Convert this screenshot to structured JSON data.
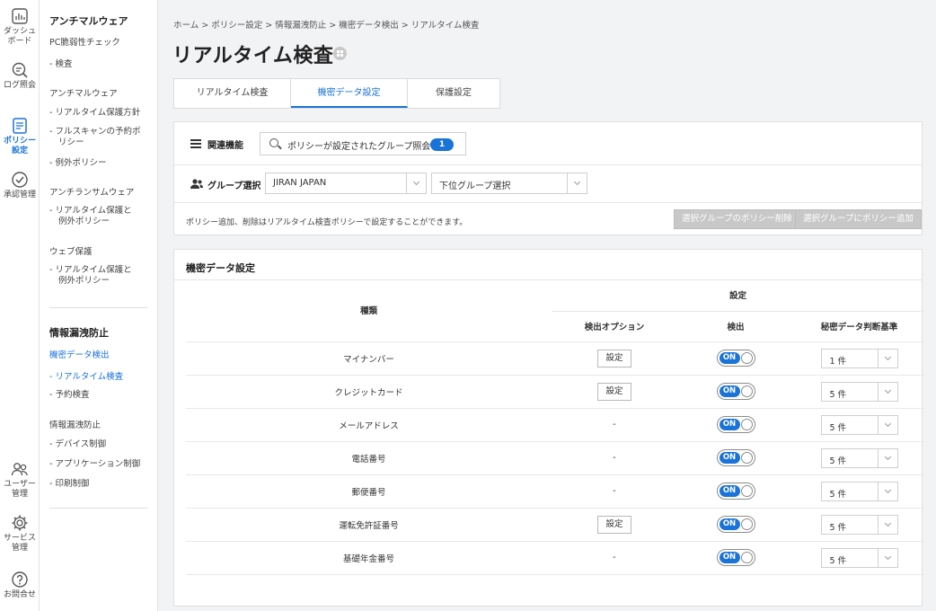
{
  "rail": {
    "items": [
      {
        "label": "ダッシュ\nボード",
        "icon": "dashboard-icon"
      },
      {
        "label": "ログ照会",
        "icon": "log-search-icon"
      },
      {
        "label": "ポリシー\n設定",
        "icon": "policy-icon",
        "active": true
      },
      {
        "label": "承認管理",
        "icon": "approval-check-icon"
      },
      {
        "label": "ユーザー\n管理",
        "icon": "users-icon"
      },
      {
        "label": "サービス\n管理",
        "icon": "gear-icon"
      },
      {
        "label": "お問合せ",
        "icon": "help-icon"
      }
    ]
  },
  "nav": {
    "antimalware_title": "アンチマルウェア",
    "pc_check": "PC脆弱性チェック",
    "inspect": "- 検査",
    "antimalware_sub": "アンチマルウェア",
    "rt_policy": "- リアルタイム保護方針",
    "fullscan_1": "- フルスキャンの予約ポ",
    "fullscan_2": "リシー",
    "exception": "- 例外ポリシー",
    "antiransom": "アンチランサムウェア",
    "ar_item_1": "- リアルタイム保護と",
    "ar_item_2": "例外ポリシー",
    "web_protect": "ウェブ保護",
    "web_item_1": "- リアルタイム保護と",
    "web_item_2": "例外ポリシー",
    "dlp_title": "情報漏洩防止",
    "confidential": "機密データ検出",
    "realtime": "- リアルタイム検査",
    "scheduled": "- 予約検査",
    "dlp_sub": "情報漏洩防止",
    "device": "- デバイス制御",
    "app": "- アプリケーション制御",
    "print": "- 印刷制御"
  },
  "header": {
    "breadcrumb": "ホーム > ポリシー設定 > 情報漏洩防止 > 機密データ検出 > リアルタイム検査",
    "title": "リアルタイム検査"
  },
  "tabs": [
    "リアルタイム検査",
    "機密データ設定",
    "保護設定"
  ],
  "related": {
    "label": "関連機能",
    "search_text": "ポリシーが設定されたグループ照会",
    "badge": "1"
  },
  "group": {
    "label": "グループ選択",
    "selected": "JIRAN JAPAN",
    "sub_placeholder": "下位グループ選択",
    "note": "ポリシー追加、削除はリアルタイム検査ポリシーで設定することができます。",
    "delete_btn": "選択グループのポリシー削除",
    "add_btn": "選択グループにポリシー追加"
  },
  "confidential_settings": {
    "title": "機密データ設定",
    "col_type": "種類",
    "col_setting": "設定",
    "col_option": "検出オプション",
    "col_detect": "検出",
    "col_criteria": "秘密データ判断基準",
    "set_label": "設定",
    "on_label": "ON",
    "rows": [
      {
        "type": "マイナンバー",
        "option": "設定",
        "criteria": "1 件"
      },
      {
        "type": "クレジットカード",
        "option": "設定",
        "criteria": "5 件"
      },
      {
        "type": "メールアドレス",
        "option": "-",
        "criteria": "5 件"
      },
      {
        "type": "電話番号",
        "option": "-",
        "criteria": "5 件"
      },
      {
        "type": "郵便番号",
        "option": "-",
        "criteria": "5 件"
      },
      {
        "type": "運転免許証番号",
        "option": "設定",
        "criteria": "5 件"
      },
      {
        "type": "基礎年金番号",
        "option": "-",
        "criteria": "5 件"
      }
    ]
  },
  "colors": {
    "accent": "#1a73d9",
    "disabled": "#c8c8c8"
  }
}
